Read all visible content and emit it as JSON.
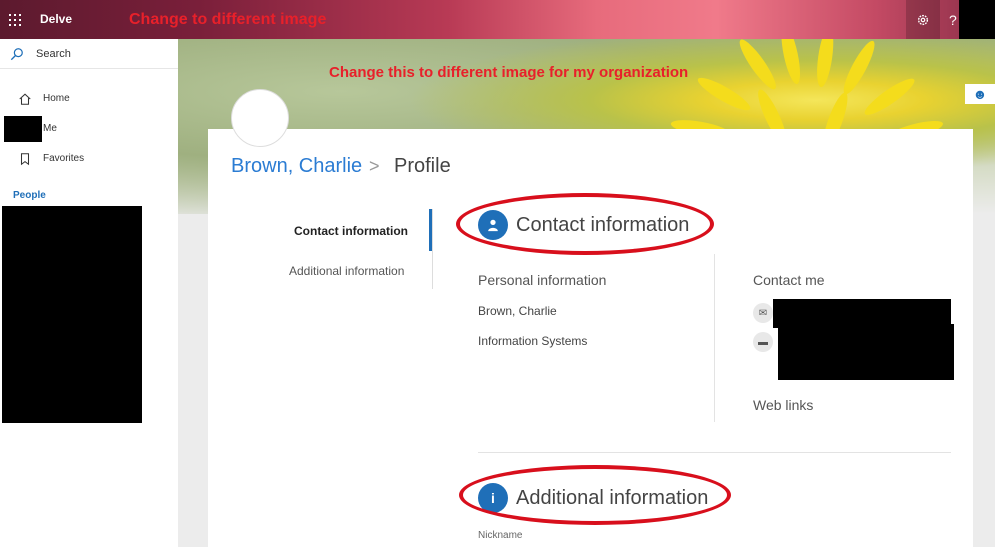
{
  "topbar": {
    "app_name": "Delve",
    "annotation": "Change to different image",
    "icons": [
      "waffle-icon",
      "gear-icon",
      "help-icon"
    ],
    "help_glyph": "?"
  },
  "sidebar": {
    "search_label": "Search",
    "items": [
      {
        "label": "Home",
        "icon": "home-icon"
      },
      {
        "label": "Me",
        "icon": "person-icon"
      },
      {
        "label": "Favorites",
        "icon": "bookmark-icon"
      }
    ],
    "section_label": "People"
  },
  "banner": {
    "annotation": "Change this to different image for my organization"
  },
  "breadcrumb": {
    "name": "Brown, Charlie",
    "separator": ">",
    "page": "Profile"
  },
  "tabs": [
    {
      "label": "Contact information",
      "active": true
    },
    {
      "label": "Additional information",
      "active": false
    }
  ],
  "contact": {
    "title": "Contact information",
    "personal_title": "Personal information",
    "name": "Brown, Charlie",
    "department": "Information Systems",
    "contact_me_title": "Contact me",
    "web_links_title": "Web links"
  },
  "additional": {
    "title": "Additional information",
    "nickname_label": "Nickname"
  },
  "colors": {
    "accent": "#1f6fb8",
    "annotation_red": "#e8202a",
    "oval_red": "#d80f1c"
  }
}
